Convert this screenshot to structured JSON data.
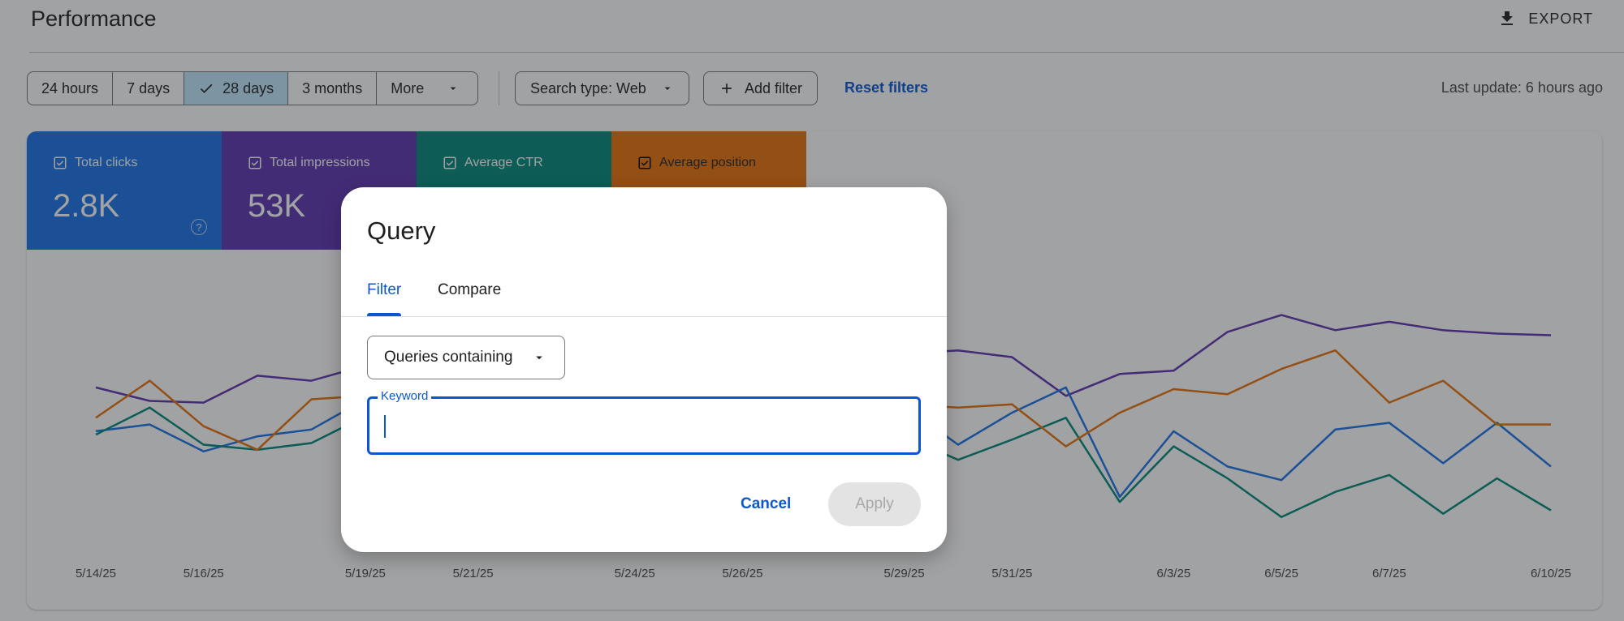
{
  "header": {
    "title": "Performance",
    "export_label": "EXPORT"
  },
  "toolbar": {
    "ranges": [
      {
        "label": "24 hours",
        "selected": false
      },
      {
        "label": "7 days",
        "selected": false
      },
      {
        "label": "28 days",
        "selected": true
      },
      {
        "label": "3 months",
        "selected": false
      },
      {
        "label": "More",
        "selected": false
      }
    ],
    "search_type_label": "Search type: Web",
    "add_filter_label": "Add filter",
    "reset_filters_label": "Reset filters",
    "last_update": "Last update: 6 hours ago"
  },
  "metrics": [
    {
      "label": "Total clicks",
      "value": "2.8K",
      "color": "#1a73e8",
      "checked": true
    },
    {
      "label": "Total impressions",
      "value": "53K",
      "color": "#5e35b1",
      "checked": true
    },
    {
      "label": "Average CTR",
      "value": "",
      "color": "#00897b",
      "checked": true
    },
    {
      "label": "Average position",
      "value": "",
      "color": "#e8710a",
      "checked": true
    }
  ],
  "chart_data": {
    "type": "line",
    "x": [
      "5/14/25",
      "5/15/25",
      "5/16/25",
      "5/17/25",
      "5/18/25",
      "5/19/25",
      "5/20/25",
      "5/21/25",
      "5/22/25",
      "5/23/25",
      "5/24/25",
      "5/25/25",
      "5/26/25",
      "5/27/25",
      "5/28/25",
      "5/29/25",
      "5/30/25",
      "5/31/25",
      "6/1/25",
      "6/2/25",
      "6/3/25",
      "6/4/25",
      "6/5/25",
      "6/6/25",
      "6/7/25",
      "6/8/25",
      "6/9/25",
      "6/10/25"
    ],
    "x_tick_labels": [
      "5/14/25",
      "5/16/25",
      "5/19/25",
      "5/21/25",
      "5/24/25",
      "5/26/25",
      "5/29/25",
      "5/31/25",
      "6/3/25",
      "6/5/25",
      "6/7/25",
      "6/10/25"
    ],
    "series": [
      {
        "color": "#5e35b1",
        "values": [
          0.49,
          0.41,
          0.4,
          0.56,
          0.53,
          0.62,
          null,
          null,
          null,
          null,
          null,
          null,
          null,
          null,
          null,
          0.69,
          0.71,
          0.67,
          0.44,
          0.57,
          0.59,
          0.82,
          0.92,
          0.83,
          0.88,
          0.83,
          0.81,
          0.8
        ]
      },
      {
        "color": "#1a73e8",
        "values": [
          0.23,
          0.27,
          0.11,
          0.2,
          0.24,
          0.42,
          null,
          null,
          null,
          null,
          null,
          null,
          null,
          null,
          null,
          0.38,
          0.15,
          0.34,
          0.49,
          -0.16,
          0.23,
          0.02,
          -0.06,
          0.24,
          0.28,
          0.04,
          0.28,
          0.02
        ]
      },
      {
        "color": "#00897b",
        "values": [
          0.21,
          0.37,
          0.15,
          0.12,
          0.16,
          0.32,
          null,
          null,
          null,
          null,
          null,
          null,
          null,
          null,
          null,
          0.2,
          0.06,
          0.18,
          0.31,
          -0.19,
          0.14,
          -0.05,
          -0.28,
          -0.13,
          -0.03,
          -0.26,
          -0.05,
          -0.24
        ]
      },
      {
        "color": "#e8710a",
        "values": [
          0.31,
          0.53,
          0.26,
          0.12,
          0.42,
          0.44,
          null,
          null,
          null,
          null,
          null,
          null,
          null,
          null,
          null,
          0.39,
          0.37,
          0.39,
          0.14,
          0.34,
          0.48,
          0.45,
          0.6,
          0.71,
          0.4,
          0.53,
          0.27,
          0.27
        ]
      }
    ],
    "legend": "top",
    "grid": false
  },
  "dialog": {
    "title": "Query",
    "tabs": [
      {
        "label": "Filter",
        "active": true
      },
      {
        "label": "Compare",
        "active": false
      }
    ],
    "select_value": "Queries containing",
    "keyword_label": "Keyword",
    "keyword_value": "",
    "cancel_label": "Cancel",
    "apply_label": "Apply"
  }
}
